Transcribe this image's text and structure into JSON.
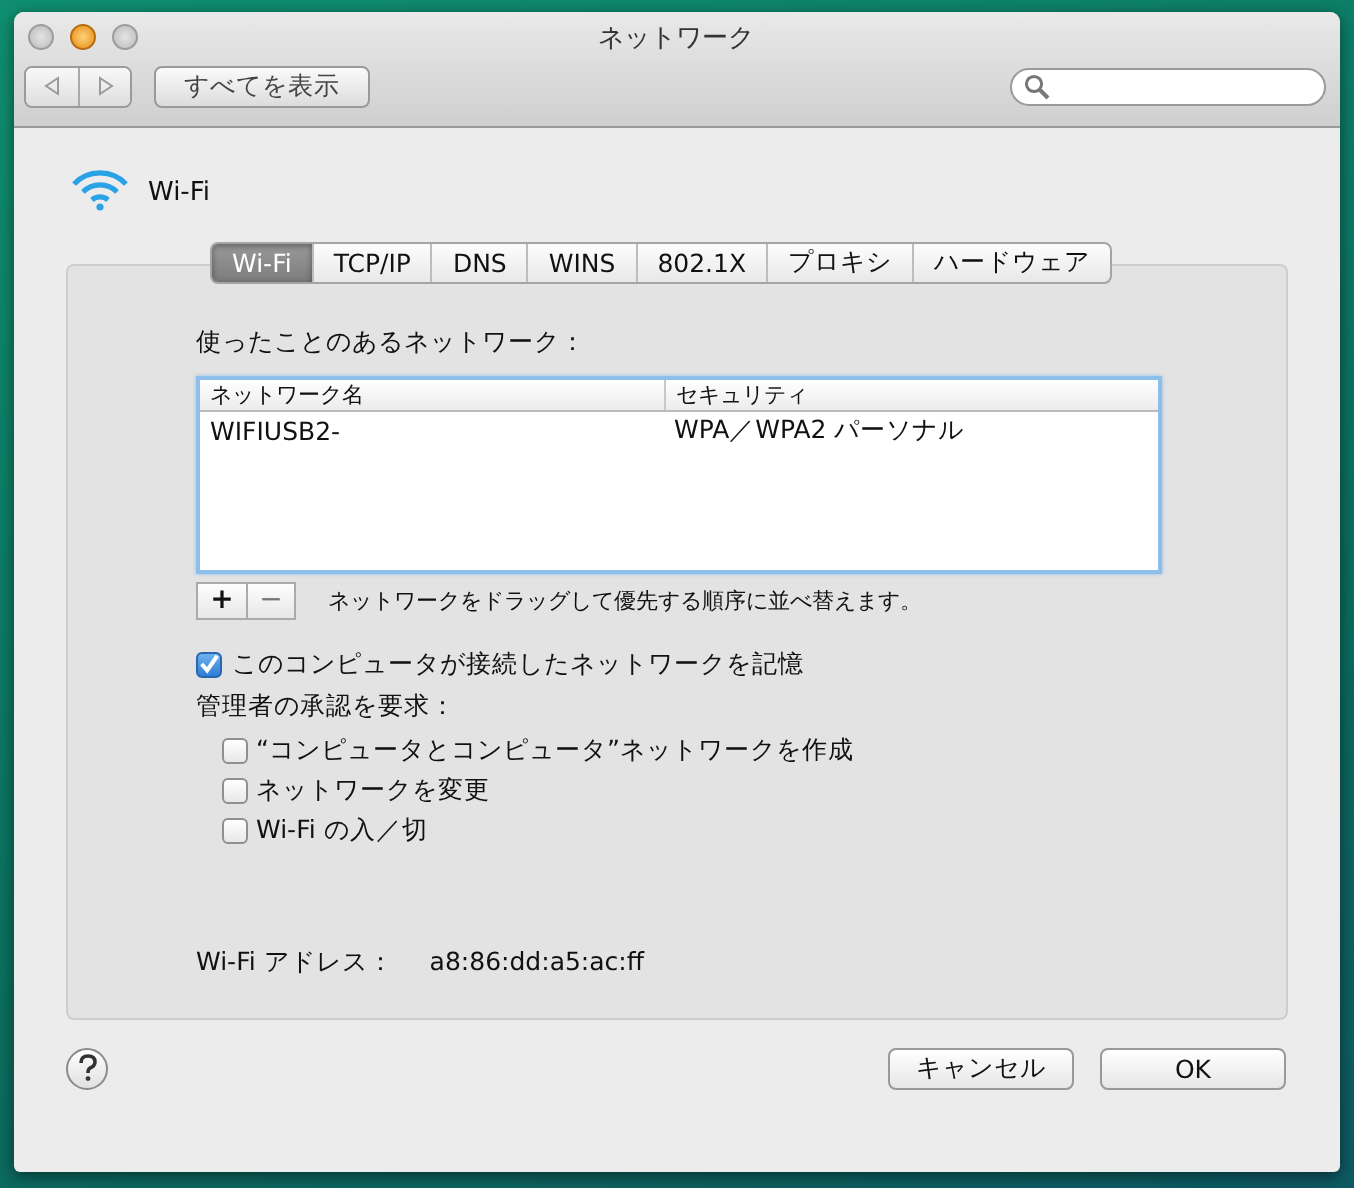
{
  "window": {
    "title": "ネットワーク",
    "show_all_button": "すべてを表示"
  },
  "service": {
    "name": "Wi-Fi"
  },
  "tabs": [
    {
      "label": "Wi-Fi",
      "selected": true
    },
    {
      "label": "TCP/IP",
      "selected": false
    },
    {
      "label": "DNS",
      "selected": false
    },
    {
      "label": "WINS",
      "selected": false
    },
    {
      "label": "802.1X",
      "selected": false
    },
    {
      "label": "プロキシ",
      "selected": false
    },
    {
      "label": "ハードウェア",
      "selected": false
    }
  ],
  "networks_label": "使ったことのあるネットワーク：",
  "table": {
    "columns": [
      "ネットワーク名",
      "セキュリティ"
    ],
    "rows": [
      {
        "cells": [
          "WIFIUSB2-",
          "WPA／WPA2 パーソナル"
        ],
        "selected": false
      }
    ]
  },
  "add_button": "+",
  "remove_button": "−",
  "drag_hint": "ネットワークをドラッグして優先する順序に並べ替えます。",
  "remember": {
    "label": "このコンピュータが接続したネットワークを記憶",
    "checked": true
  },
  "admin_label": "管理者の承認を要求：",
  "admin_options": [
    {
      "label": "“コンピュータとコンピュータ”ネットワークを作成",
      "checked": false
    },
    {
      "label": "ネットワークを変更",
      "checked": false
    },
    {
      "label": "Wi-Fi の入／切",
      "checked": false
    }
  ],
  "address": {
    "label": "Wi-Fi アドレス：",
    "value": "a8:86:dd:a5:ac:ff"
  },
  "buttons": {
    "cancel": "キャンセル",
    "ok": "OK"
  }
}
